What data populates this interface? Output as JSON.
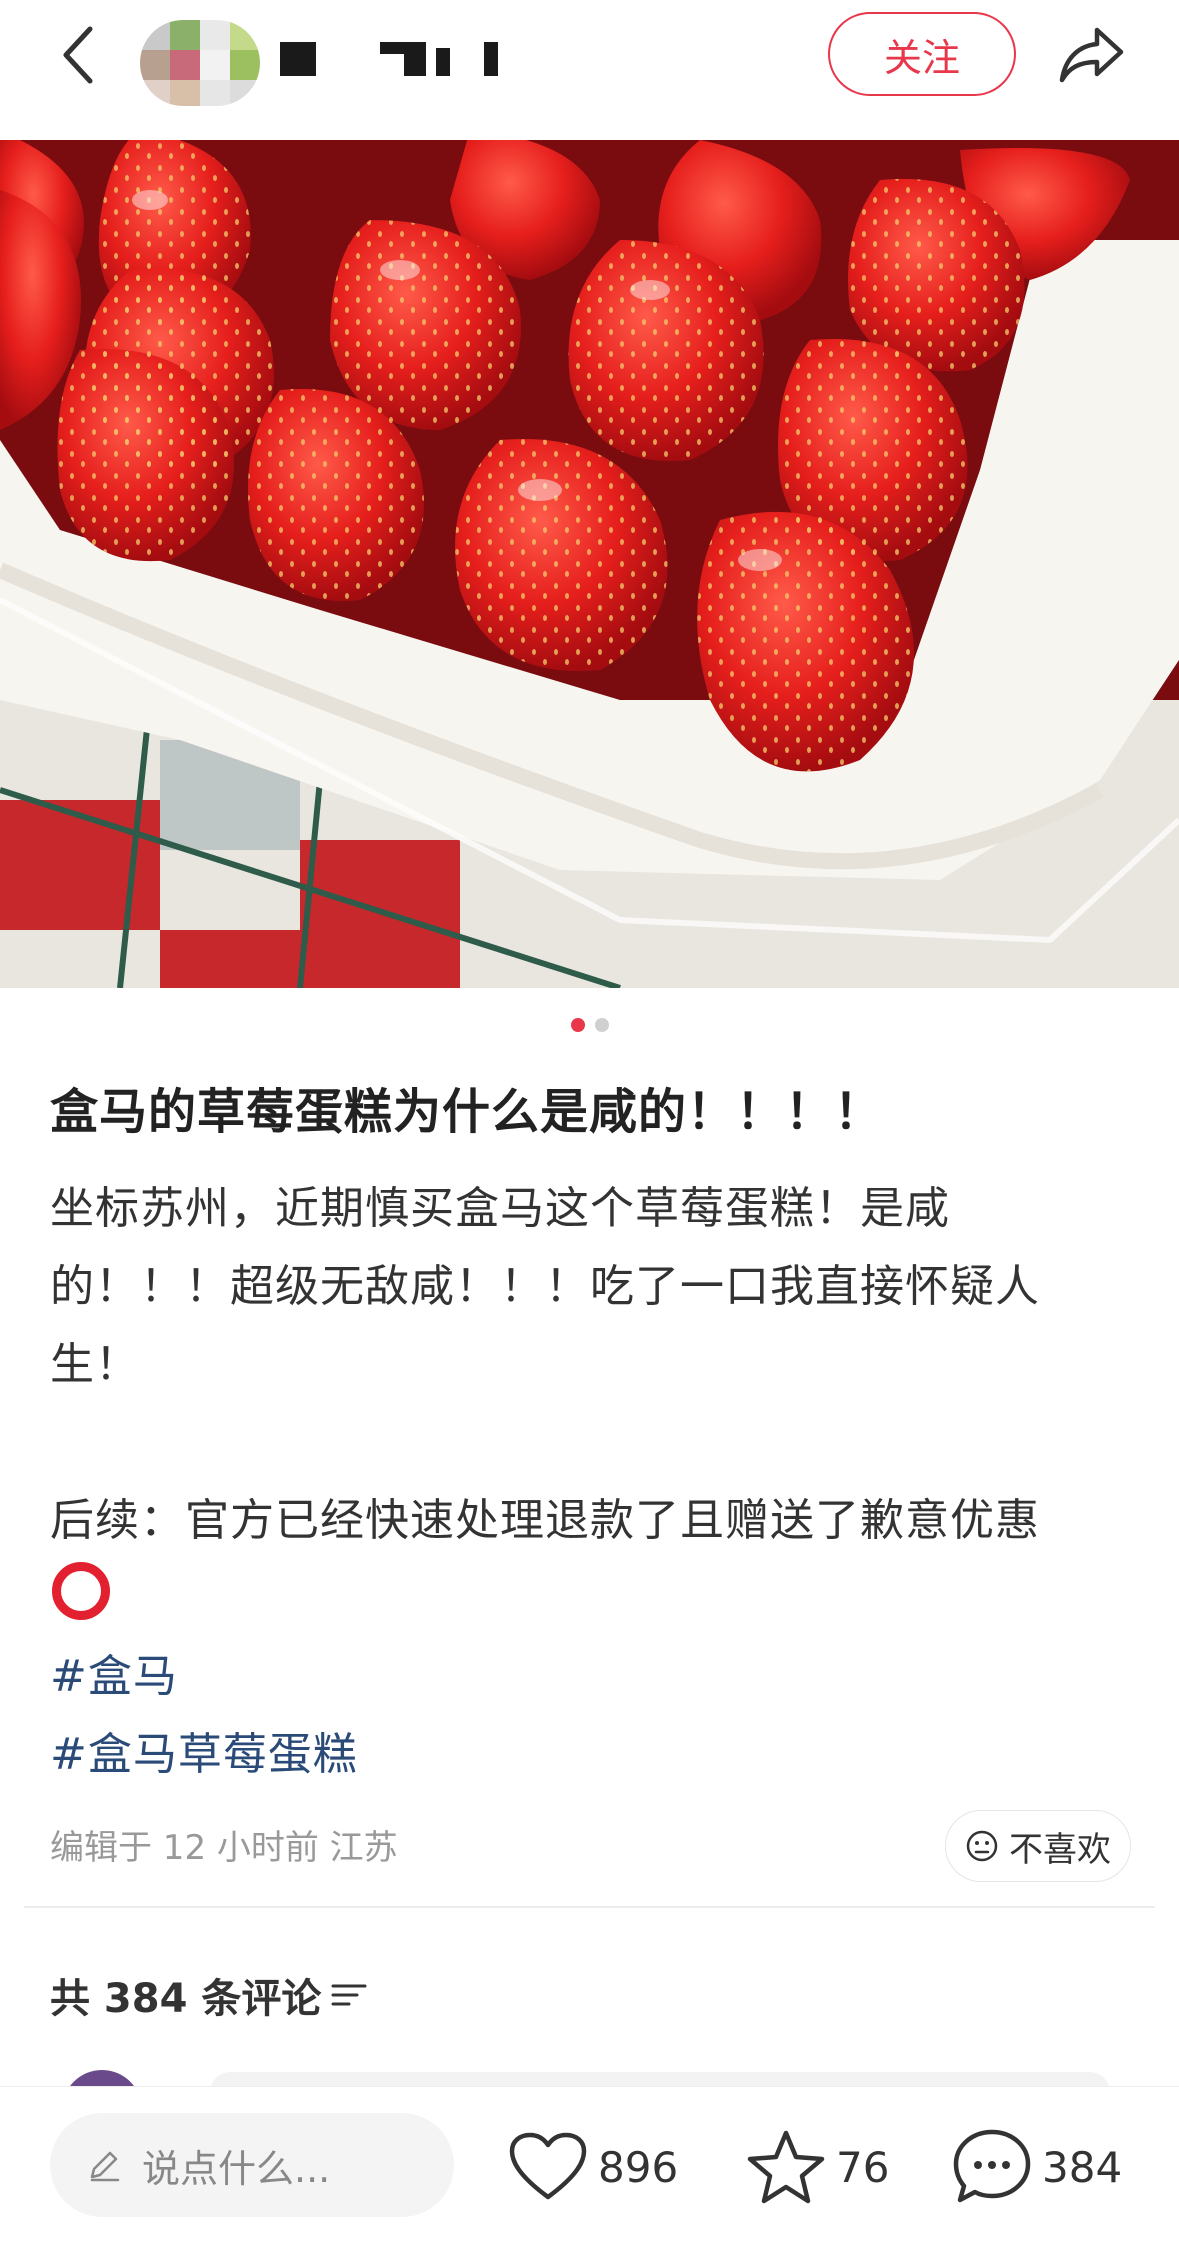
{
  "header": {
    "follow_label": "关注"
  },
  "post": {
    "title": "盒马的草莓蛋糕为什么是咸的！！！！",
    "body": "坐标苏州，近期慎买盒马这个草莓蛋糕！是咸\n的！！！超级无敌咸！！！吃了一口我直接怀疑人\n生！\n\n后续：官方已经快速处理退款了且赠送了歉意优惠",
    "tags": [
      "#盒马",
      "#盒马草莓蛋糕"
    ],
    "meta": "编辑于 12 小时前 江苏",
    "dislike_label": "不喜欢",
    "carousel": {
      "count": 2,
      "active_index": 0
    }
  },
  "comments": {
    "count_label": "共 384 条评论"
  },
  "bottom_bar": {
    "input_placeholder": "说点什么...",
    "likes": "896",
    "stars": "76",
    "comments": "384"
  },
  "icons": {
    "back": "chevron-left-icon",
    "share": "share-arrow-icon",
    "dislike": "frown-face-icon",
    "filter": "filter-lines-icon",
    "edit": "pencil-icon",
    "like": "heart-icon",
    "star": "star-icon",
    "comment": "chat-bubble-icon"
  },
  "colors": {
    "accent": "#e8374b",
    "tag": "#2a4a78",
    "muted": "#999999"
  }
}
